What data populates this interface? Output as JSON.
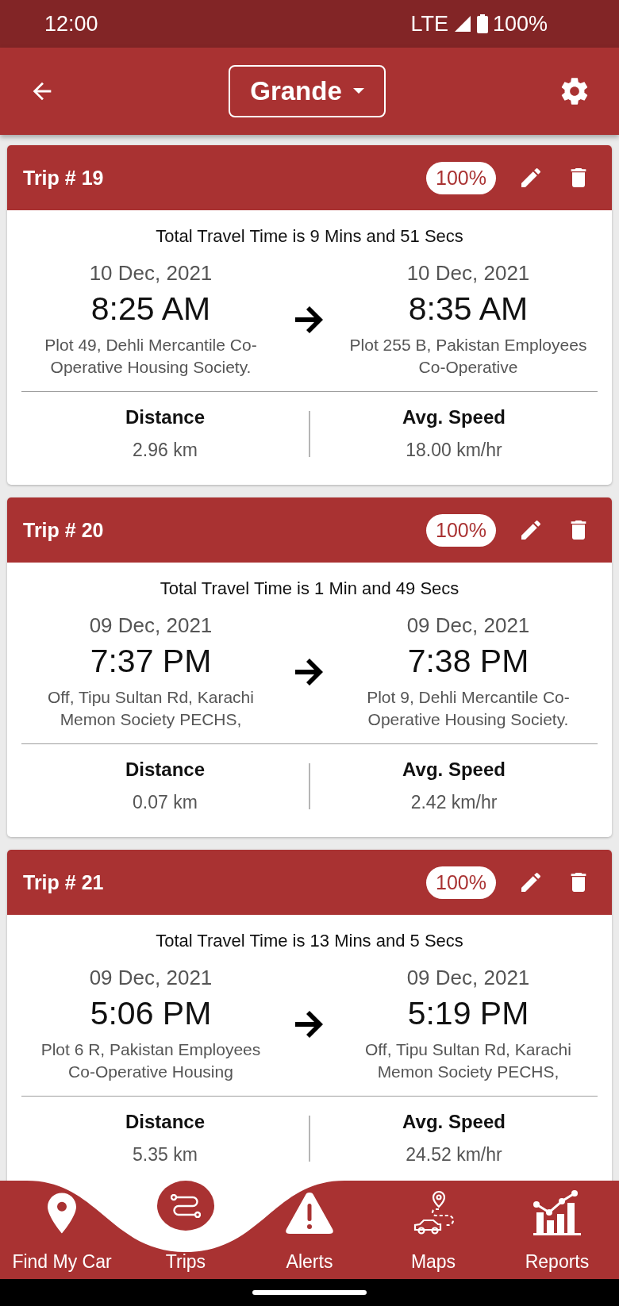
{
  "status_bar": {
    "time": "12:00",
    "network": "LTE",
    "battery": "100%"
  },
  "app_bar": {
    "vehicle": "Grande"
  },
  "trips": [
    {
      "title": "Trip # 19",
      "badge": "100%",
      "travel_time": "Total Travel Time is 9 Mins and 51 Secs",
      "start": {
        "date": "10 Dec, 2021",
        "time": "8:25 AM",
        "address": "Plot 49, Dehli Mercantile Co-Operative Housing Society."
      },
      "end": {
        "date": "10 Dec, 2021",
        "time": "8:35 AM",
        "address": "Plot 255 B, Pakistan Employees Co-Operative"
      },
      "distance_label": "Distance",
      "distance": "2.96 km",
      "speed_label": "Avg. Speed",
      "speed": "18.00 km/hr"
    },
    {
      "title": "Trip # 20",
      "badge": "100%",
      "travel_time": "Total Travel Time is 1 Min and 49 Secs",
      "start": {
        "date": "09 Dec, 2021",
        "time": "7:37 PM",
        "address": "Off, Tipu Sultan Rd, Karachi Memon Society PECHS,"
      },
      "end": {
        "date": "09 Dec, 2021",
        "time": "7:38 PM",
        "address": "Plot 9, Dehli Mercantile Co-Operative Housing Society."
      },
      "distance_label": "Distance",
      "distance": "0.07 km",
      "speed_label": "Avg. Speed",
      "speed": "2.42 km/hr"
    },
    {
      "title": "Trip # 21",
      "badge": "100%",
      "travel_time": "Total Travel Time is 13 Mins and 5 Secs",
      "start": {
        "date": "09 Dec, 2021",
        "time": "5:06 PM",
        "address": "Plot 6 R, Pakistan Employees Co-Operative Housing"
      },
      "end": {
        "date": "09 Dec, 2021",
        "time": "5:19 PM",
        "address": "Off, Tipu Sultan Rd, Karachi Memon Society PECHS,"
      },
      "distance_label": "Distance",
      "distance": "5.35 km",
      "speed_label": "Avg. Speed",
      "speed": "24.52 km/hr"
    }
  ],
  "bottom_nav": [
    {
      "kind": "pin",
      "label": "Find My Car",
      "selected": false
    },
    {
      "kind": "route",
      "label": "Trips",
      "selected": true
    },
    {
      "kind": "alert",
      "label": "Alerts",
      "selected": false
    },
    {
      "kind": "map",
      "label": "Maps",
      "selected": false
    },
    {
      "kind": "chart",
      "label": "Reports",
      "selected": false
    }
  ]
}
